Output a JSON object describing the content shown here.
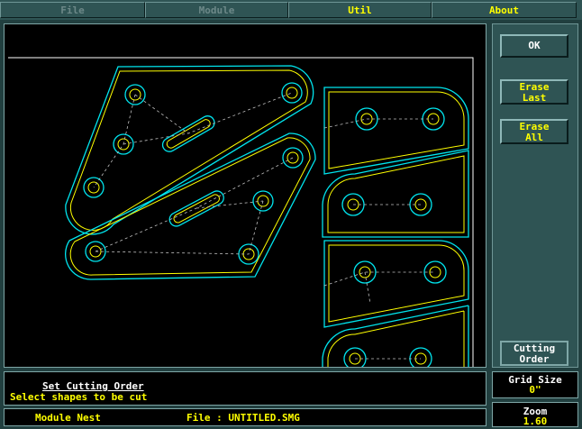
{
  "menu": {
    "items": [
      {
        "label": "File",
        "enabled": false
      },
      {
        "label": "Module",
        "enabled": false
      },
      {
        "label": "Util",
        "enabled": true
      },
      {
        "label": "About",
        "enabled": true
      }
    ]
  },
  "panel": {
    "ok_label": "OK",
    "erase_last_1": "Erase",
    "erase_last_2": "Last",
    "erase_all_1": "Erase",
    "erase_all_2": "All",
    "cutting_order_1": "Cutting",
    "cutting_order_2": "Order"
  },
  "message": {
    "title": "Set Cutting Order",
    "line": "Select shapes to be cut"
  },
  "status": {
    "module": "Module Nest",
    "file": "File : UNTITLED.SMG"
  },
  "grid": {
    "label": "Grid Size",
    "value": "0\""
  },
  "zoom": {
    "label": "Zoom",
    "value": "1.60"
  },
  "colors": {
    "part_outline": "#00e5ee",
    "cut_path": "#ffff00",
    "sheet_border": "#ffffff",
    "hole": "#ffff00",
    "path_link": "#c0c0c0"
  }
}
